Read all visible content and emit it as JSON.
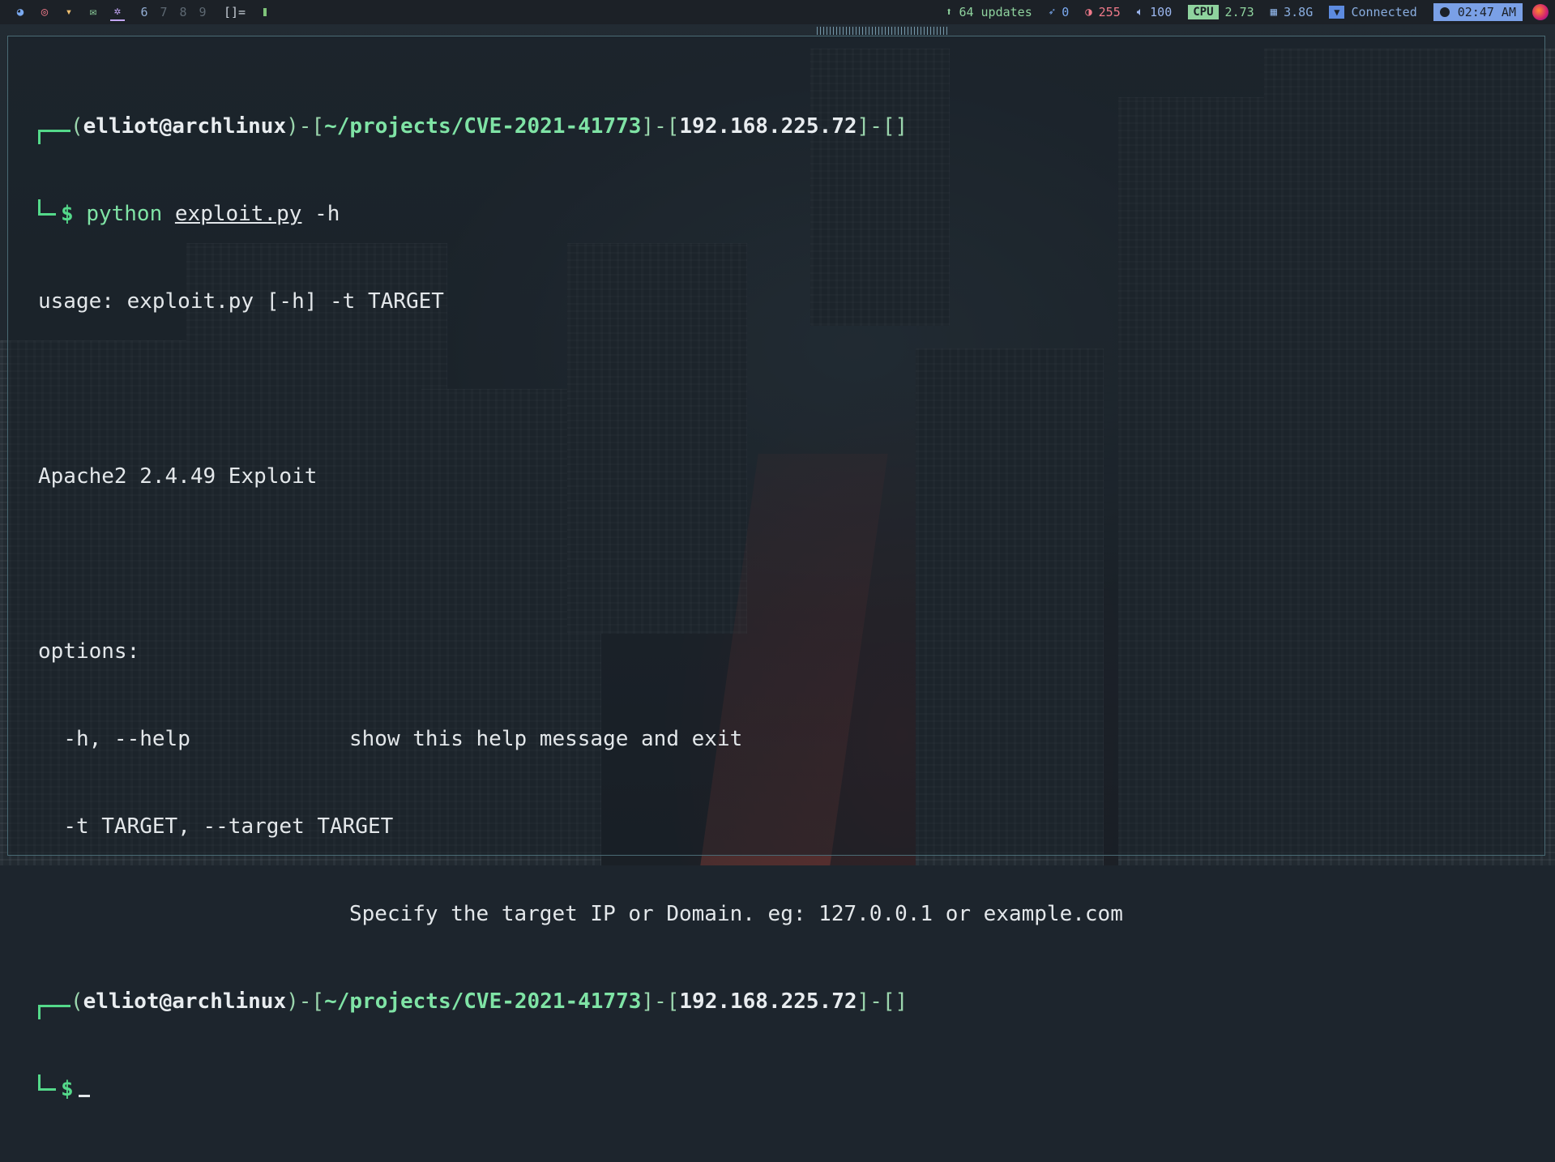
{
  "topbar": {
    "apps": [
      {
        "name": "firefox-icon",
        "glyph": "◕",
        "color": "#7aa9f0"
      },
      {
        "name": "chrome-icon",
        "glyph": "◎",
        "color": "#f07a8a"
      },
      {
        "name": "pocket-icon",
        "glyph": "▾",
        "color": "#f0c070"
      },
      {
        "name": "mail-icon",
        "glyph": "✉",
        "color": "#8fd39e"
      }
    ],
    "active_ws_icon": "✲",
    "workspaces": [
      "6",
      "7",
      "8",
      "9"
    ],
    "layout": "[]=",
    "updates": "64 updates",
    "cpu_work": "0",
    "brightness": "255",
    "volume": "100",
    "cpu_label": "CPU",
    "cpu_value": "2.73",
    "memory": "3.8G",
    "network": "Connected",
    "clock": "02:47 AM"
  },
  "terminal": {
    "prompt1": {
      "user": "elliot@archlinux",
      "path": "~/projects/CVE-2021-41773",
      "ip": "192.168.225.72",
      "tail": "[]"
    },
    "command": {
      "dollar": "$",
      "program": "python",
      "file": "exploit.py",
      "flag": "-h"
    },
    "output": {
      "usage": "usage: exploit.py [-h] -t TARGET",
      "description": "Apache2 2.4.49 Exploit",
      "options_header": "options:",
      "opt1_flags": "-h, --help",
      "opt1_desc": "show this help message and exit",
      "opt2_flags": "-t TARGET, --target TARGET",
      "opt2_desc": "Specify the target IP or Domain. eg: 127.0.0.1 or example.com"
    },
    "prompt2": {
      "user": "elliot@archlinux",
      "path": "~/projects/CVE-2021-41773",
      "ip": "192.168.225.72",
      "tail": "[]",
      "dollar": "$"
    }
  }
}
